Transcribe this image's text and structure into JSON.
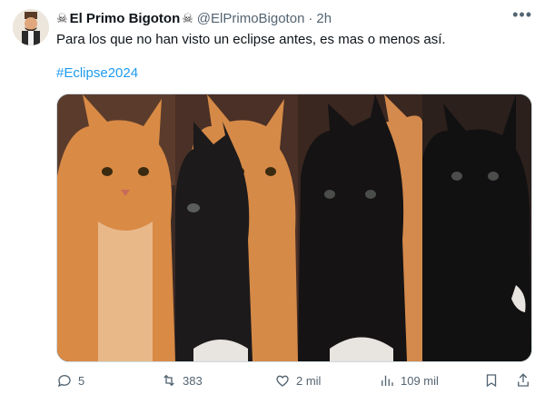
{
  "author": {
    "display_name": "El Primo Bigoton",
    "handle": "@ElPrimoBigoton",
    "separator": "·",
    "time": "2h"
  },
  "tweet": {
    "text": "Para los que no han visto un eclipse antes, es mas o menos así.",
    "hashtag": "#Eclipse2024"
  },
  "metrics": {
    "replies": "5",
    "retweets": "383",
    "likes": "2 mil",
    "views": "109 mil"
  },
  "icons": {
    "more": "more-options-icon",
    "reply": "reply-icon",
    "retweet": "retweet-icon",
    "like": "heart-icon",
    "views": "views-icon",
    "bookmark": "bookmark-icon",
    "share": "share-icon"
  },
  "colors": {
    "link": "#1d9bf0",
    "secondary": "#536471",
    "text": "#0f1419"
  }
}
